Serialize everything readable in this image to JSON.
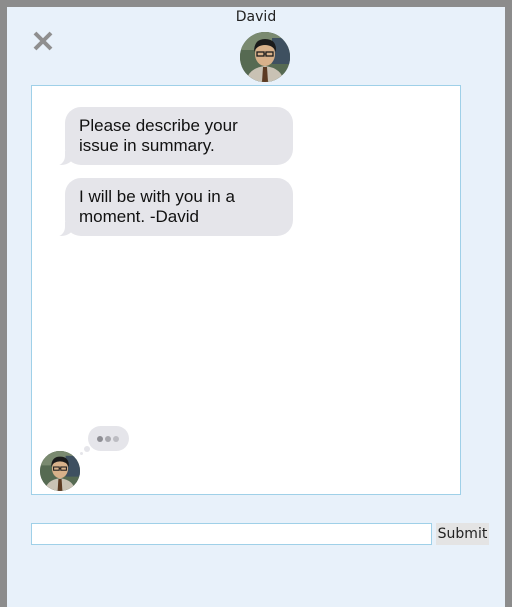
{
  "agent": {
    "name": "David"
  },
  "header": {
    "close_icon": "close-icon"
  },
  "messages": [
    {
      "text": "Please describe your issue in summary."
    },
    {
      "text": "I will be with you in a moment. -David"
    }
  ],
  "typing_indicator": {
    "icon": "typing-dots-icon"
  },
  "composer": {
    "input_value": "",
    "input_placeholder": "",
    "submit_label": "Submit"
  },
  "colors": {
    "panel_background": "#e8f1fa",
    "bubble_background": "#e5e5ea",
    "border_accent": "#9fd0e8"
  }
}
